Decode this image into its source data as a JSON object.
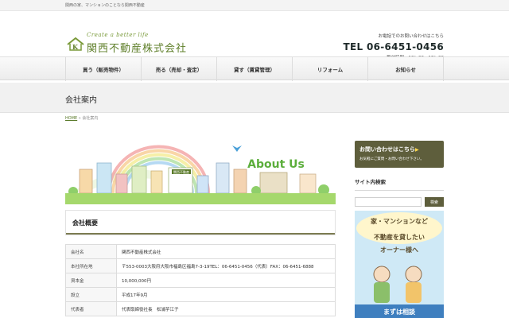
{
  "topbar": {
    "text": "関西の家、マンションのことなら関西不動産"
  },
  "logo": {
    "tagline": "Create a better life",
    "company": "関西不動産株式会社"
  },
  "contact": {
    "note": "お電話でのお問い合わせはこちら",
    "tel": "TEL 06-6451-0456",
    "hours": "受付時間　10：00〜18：00"
  },
  "nav": [
    {
      "label": "買う（販売物件）"
    },
    {
      "label": "売る（売却・査定）"
    },
    {
      "label": "貸す（賃貸管理）"
    },
    {
      "label": "リフォーム"
    },
    {
      "label": "お知らせ"
    }
  ],
  "page": {
    "title": "会社案内"
  },
  "breadcrumb": {
    "home": "HOME",
    "sep": " » ",
    "current": "会社案内"
  },
  "hero": {
    "title": "About Us",
    "sign": "関西不動産"
  },
  "section": {
    "heading": "会社概要"
  },
  "table": [
    {
      "label": "会社名",
      "value": "関西不動産株式会社"
    },
    {
      "label": "本社所在地",
      "value": "〒553-0003大阪府大阪市福島区福島7-3-19TEL：06-6451-0456（代表）FAX：06-6451-6888"
    },
    {
      "label": "資本金",
      "value": "10,000,000円"
    },
    {
      "label": "設立",
      "value": "平成17年9月"
    },
    {
      "label": "代表者",
      "value": "代表取締役社長　松浦芋江子"
    }
  ],
  "sidebar": {
    "cta_title": "お問い合わせはこちら",
    "cta_arrow": "▶",
    "cta_sub": "お気軽にご質問・お問い合わせ下さい。",
    "search_heading": "サイト内検索",
    "search_placeholder": "",
    "search_button": "検索"
  },
  "banner": {
    "line1": "家・マンションなど",
    "line2": "不動産を貸したい",
    "line3": "オーナー様へ",
    "bottom": "まずは相談"
  },
  "colors": {
    "accent": "#5e5e3c",
    "brand_green": "#5f7f2a",
    "sky": "#cfe9f6"
  }
}
